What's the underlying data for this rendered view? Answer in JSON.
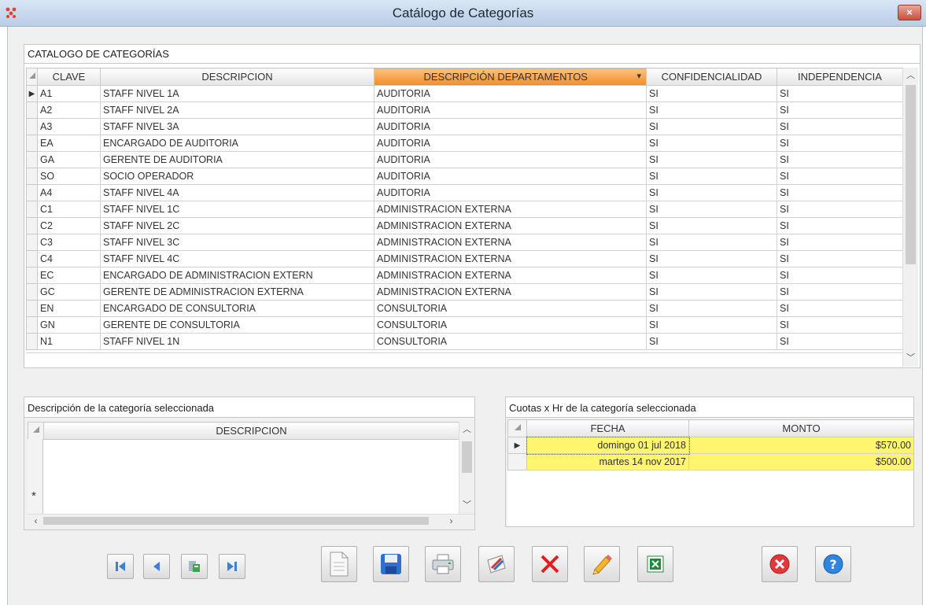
{
  "window": {
    "title": "Catálogo de Categorías",
    "close_glyph": "×",
    "close_icon": "close-icon"
  },
  "catalog": {
    "caption": "CATALOGO DE CATEGORÍAS",
    "columns": [
      "CLAVE",
      "DESCRIPCION",
      "DESCRIPCIÓN DEPARTAMENTOS",
      "CONFIDENCIALIDAD",
      "INDEPENDENCIA"
    ],
    "sort_glyph": "▾",
    "current_row_glyph": "▶",
    "rows": [
      {
        "clave": "A1",
        "descripcion": "STAFF NIVEL 1A",
        "departamento": "AUDITORIA",
        "confidencialidad": "SI",
        "independencia": "SI"
      },
      {
        "clave": "A2",
        "descripcion": "STAFF NIVEL 2A",
        "departamento": "AUDITORIA",
        "confidencialidad": "SI",
        "independencia": "SI"
      },
      {
        "clave": "A3",
        "descripcion": "STAFF NIVEL 3A",
        "departamento": "AUDITORIA",
        "confidencialidad": "SI",
        "independencia": "SI"
      },
      {
        "clave": "EA",
        "descripcion": "ENCARGADO DE AUDITORIA",
        "departamento": "AUDITORIA",
        "confidencialidad": "SI",
        "independencia": "SI"
      },
      {
        "clave": "GA",
        "descripcion": "GERENTE DE AUDITORIA",
        "departamento": "AUDITORIA",
        "confidencialidad": "SI",
        "independencia": "SI"
      },
      {
        "clave": "SO",
        "descripcion": "SOCIO OPERADOR",
        "departamento": "AUDITORIA",
        "confidencialidad": "SI",
        "independencia": "SI"
      },
      {
        "clave": "A4",
        "descripcion": "STAFF NIVEL 4A",
        "departamento": "AUDITORIA",
        "confidencialidad": "SI",
        "independencia": "SI"
      },
      {
        "clave": "C1",
        "descripcion": "STAFF NIVEL 1C",
        "departamento": "ADMINISTRACION EXTERNA",
        "confidencialidad": "SI",
        "independencia": "SI"
      },
      {
        "clave": "C2",
        "descripcion": "STAFF NIVEL 2C",
        "departamento": "ADMINISTRACION EXTERNA",
        "confidencialidad": "SI",
        "independencia": "SI"
      },
      {
        "clave": "C3",
        "descripcion": "STAFF NIVEL 3C",
        "departamento": "ADMINISTRACION EXTERNA",
        "confidencialidad": "SI",
        "independencia": "SI"
      },
      {
        "clave": "C4",
        "descripcion": "STAFF NIVEL 4C",
        "departamento": "ADMINISTRACION EXTERNA",
        "confidencialidad": "SI",
        "independencia": "SI"
      },
      {
        "clave": "EC",
        "descripcion": "ENCARGADO DE ADMINISTRACION EXTERN",
        "departamento": "ADMINISTRACION EXTERNA",
        "confidencialidad": "SI",
        "independencia": "SI"
      },
      {
        "clave": "GC",
        "descripcion": "GERENTE DE ADMINISTRACION EXTERNA",
        "departamento": "ADMINISTRACION EXTERNA",
        "confidencialidad": "SI",
        "independencia": "SI"
      },
      {
        "clave": "EN",
        "descripcion": "ENCARGADO DE CONSULTORIA",
        "departamento": "CONSULTORIA",
        "confidencialidad": "SI",
        "independencia": "SI"
      },
      {
        "clave": "GN",
        "descripcion": "GERENTE DE CONSULTORIA",
        "departamento": "CONSULTORIA",
        "confidencialidad": "SI",
        "independencia": "SI"
      },
      {
        "clave": "N1",
        "descripcion": "STAFF NIVEL 1N",
        "departamento": "CONSULTORIA",
        "confidencialidad": "SI",
        "independencia": "SI"
      }
    ]
  },
  "description_panel": {
    "caption": "Descripción de la categoría seleccionada",
    "column": "DESCRIPCION",
    "new_row_glyph": "*"
  },
  "rates_panel": {
    "caption": "Cuotas x Hr de la categoría seleccionada",
    "columns": [
      "FECHA",
      "MONTO"
    ],
    "current_row_glyph": "▶",
    "rows": [
      {
        "fecha": "domingo 01 jul 2018",
        "monto": "$570.00"
      },
      {
        "fecha": "martes 14 nov 2017",
        "monto": "$500.00"
      }
    ],
    "highlight_color": "#fff56e"
  },
  "toolbar": {
    "buttons": [
      "first-record",
      "previous-record",
      "goto-record",
      "last-record",
      "new-document",
      "save",
      "print",
      "edit-form",
      "delete",
      "edit-pencil",
      "export-excel",
      "cancel",
      "help"
    ]
  },
  "colors": {
    "active_header": "#f5a04a",
    "nav_blue": "#3e7fd6",
    "delete_red": "#e02020",
    "excel_green": "#1f8a3a"
  }
}
